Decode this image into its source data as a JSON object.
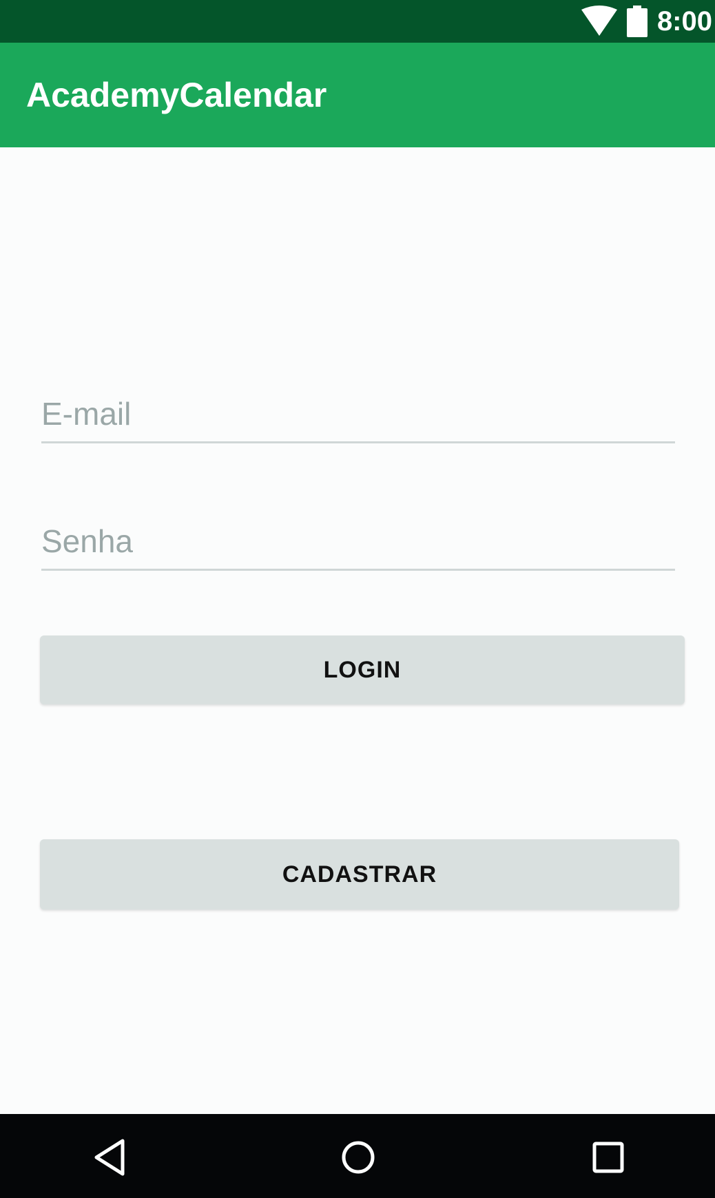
{
  "status_bar": {
    "time": "8:00",
    "icons": [
      "wifi-icon",
      "battery-icon"
    ],
    "background_color": "#04552a"
  },
  "app_bar": {
    "title": "AcademyCalendar",
    "background_color": "#1ba85a"
  },
  "form": {
    "email": {
      "placeholder": "E-mail",
      "value": ""
    },
    "senha": {
      "placeholder": "Senha",
      "value": ""
    },
    "login_label": "LOGIN",
    "cadastrar_label": "CADASTRAR"
  },
  "nav_bar": {
    "icons": [
      "back-icon",
      "home-icon",
      "recents-icon"
    ],
    "background_color": "#050608"
  }
}
